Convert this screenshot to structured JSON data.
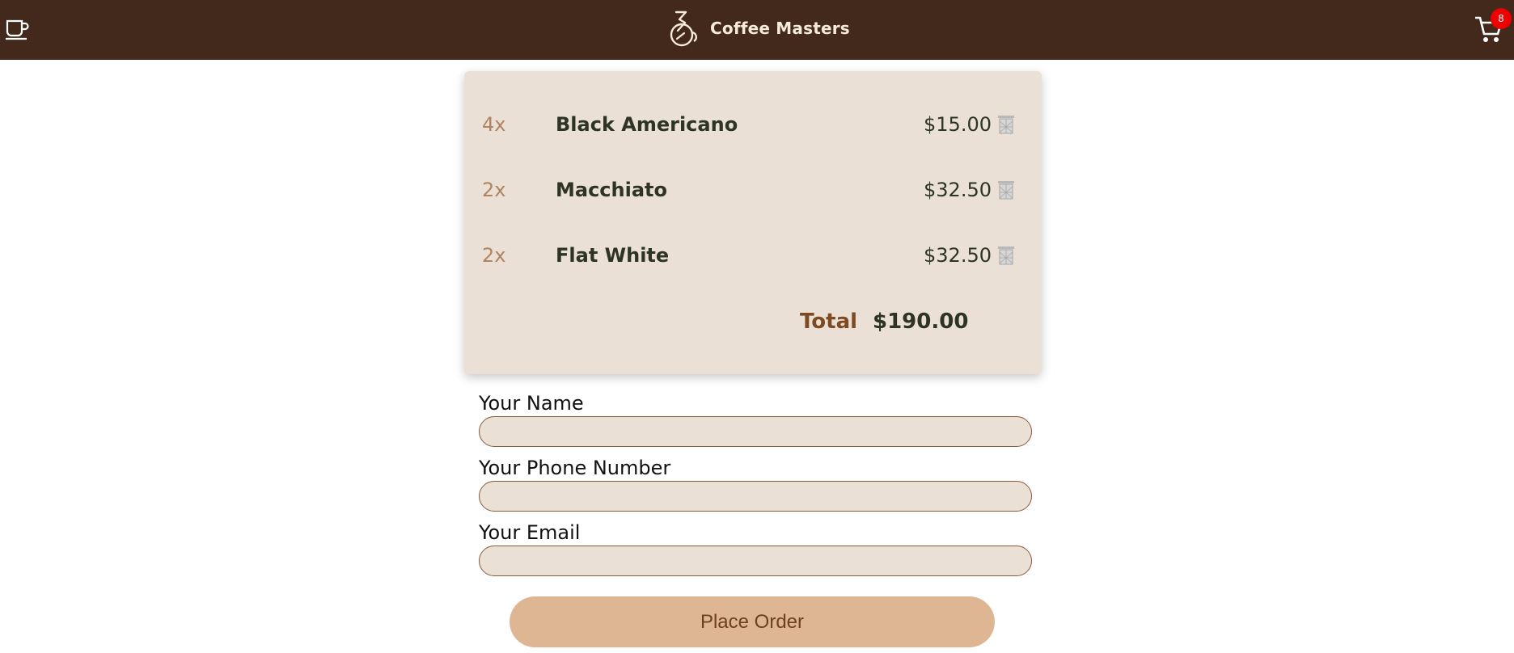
{
  "header": {
    "title": "Coffee Masters",
    "menu_icon": "coffee-cup-icon",
    "logo_icon": "coffee-logo-icon",
    "cart_icon": "cart-icon",
    "cart_count": "8"
  },
  "cart": {
    "items": [
      {
        "qty": "4x",
        "name": "Black Americano",
        "price": "$15.00"
      },
      {
        "qty": "2x",
        "name": "Macchiato",
        "price": "$32.50"
      },
      {
        "qty": "2x",
        "name": "Flat White",
        "price": "$32.50"
      }
    ],
    "total_label": "Total",
    "total_value": "$190.00"
  },
  "form": {
    "name_label": "Your Name",
    "name_value": "",
    "phone_label": "Your Phone Number",
    "phone_value": "",
    "email_label": "Your Email",
    "email_value": "",
    "submit_label": "Place Order"
  },
  "colors": {
    "header_bg": "#43281c",
    "card_bg": "#ebe0d5",
    "button_bg": "#dfb693",
    "badge": "#ee0000"
  }
}
